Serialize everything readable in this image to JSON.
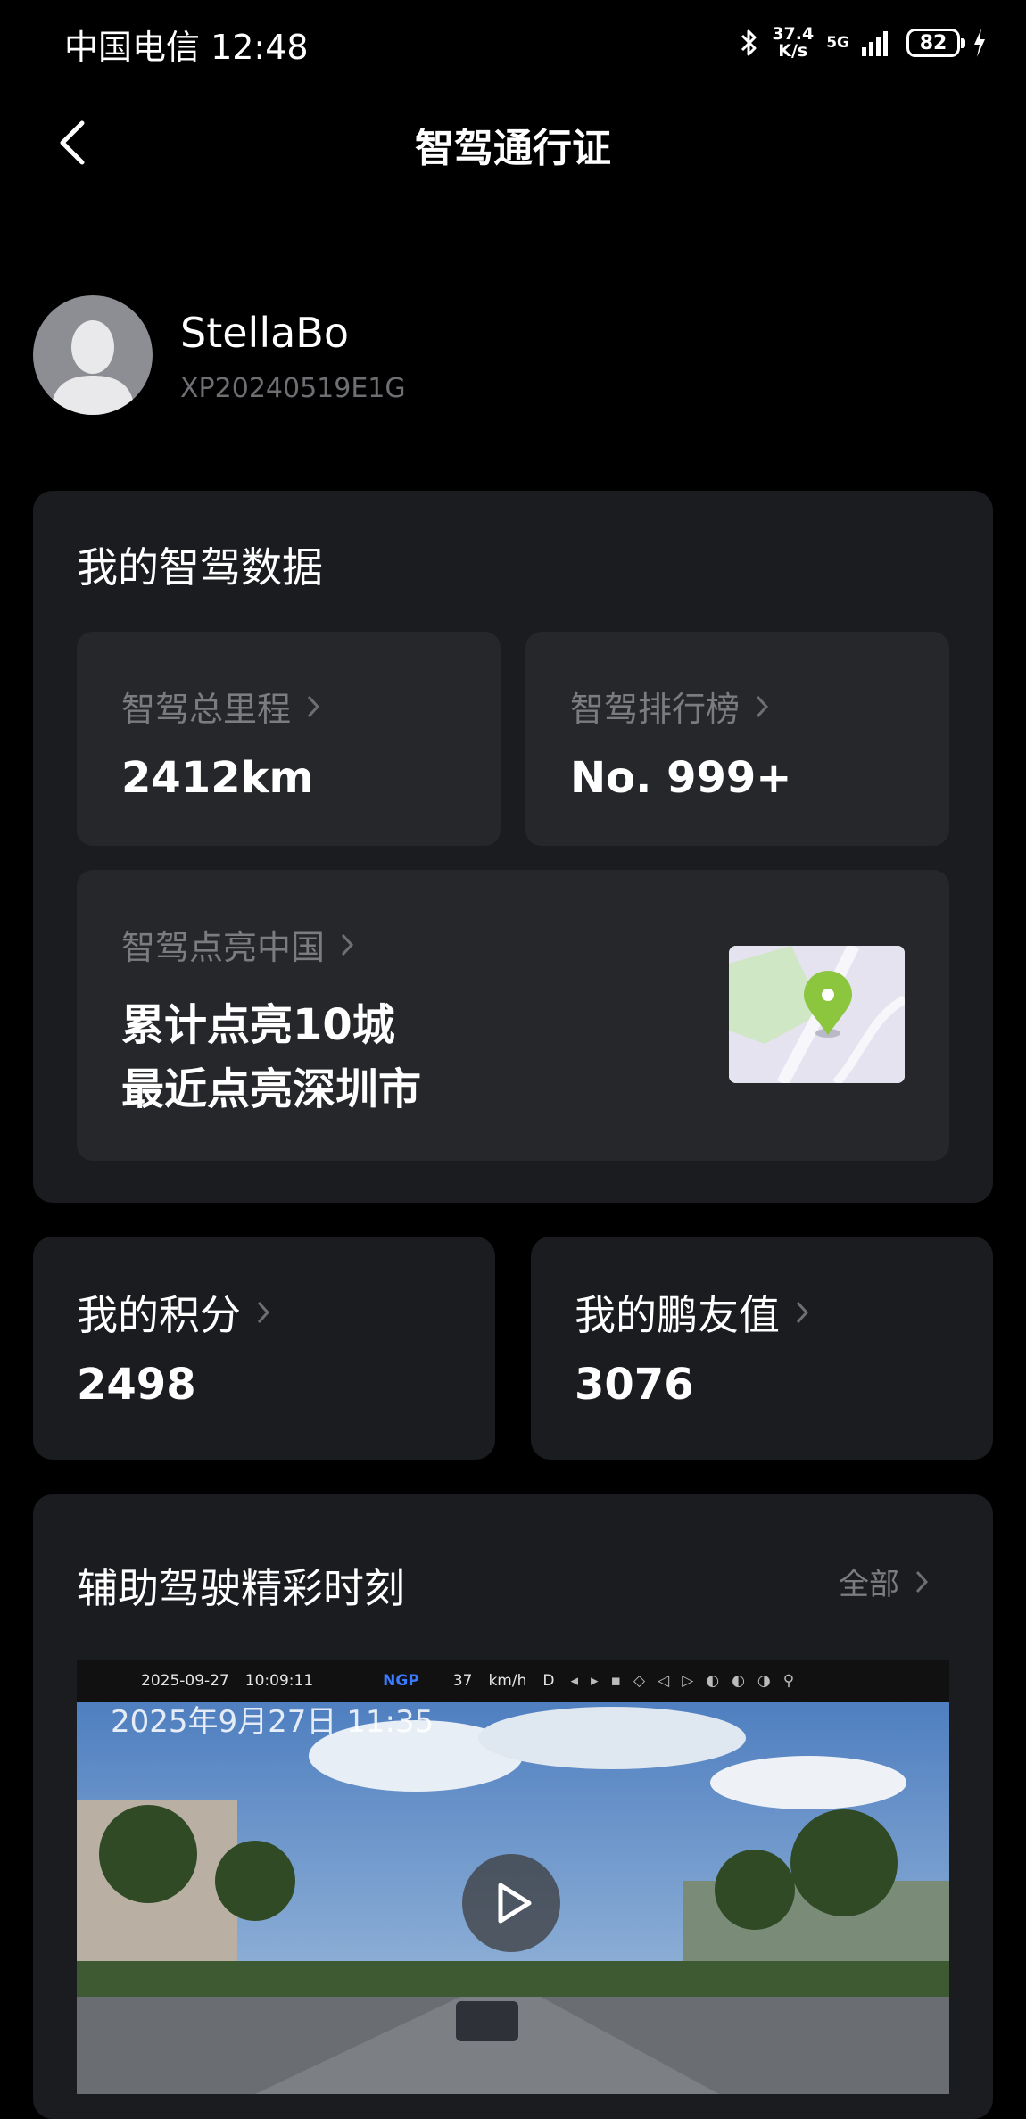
{
  "status_bar": {
    "carrier_time": "中国电信 12:48",
    "net_speed_value": "37.4",
    "net_speed_unit": "K/s",
    "network": "5G",
    "battery": "82"
  },
  "nav": {
    "title": "智驾通行证"
  },
  "profile": {
    "name": "StellaBo",
    "id": "XP20240519E1G"
  },
  "smart_drive": {
    "title": "我的智驾数据",
    "mileage_label": "智驾总里程",
    "mileage_value": "2412km",
    "rank_label": "智驾排行榜",
    "rank_value": "No. 999+",
    "light_label": "智驾点亮中国",
    "light_line1": "累计点亮10城",
    "light_line2": "最近点亮深圳市"
  },
  "points": {
    "label": "我的积分",
    "value": "2498"
  },
  "friend": {
    "label": "我的鹏友值",
    "value": "3076"
  },
  "moments": {
    "title": "辅助驾驶精彩时刻",
    "all_label": "全部",
    "video": {
      "osd_date": "2025-09-27",
      "osd_time": "10:09:11",
      "osd_mode": "NGP",
      "osd_speed": "37",
      "osd_unit": "km/h",
      "osd_gear": "D",
      "stamp": "2025年9月27日 11:35"
    }
  },
  "colors": {
    "accent_green": "#8cc63f",
    "card_bg": "#1b1c20",
    "inner_bg": "#26272b"
  }
}
